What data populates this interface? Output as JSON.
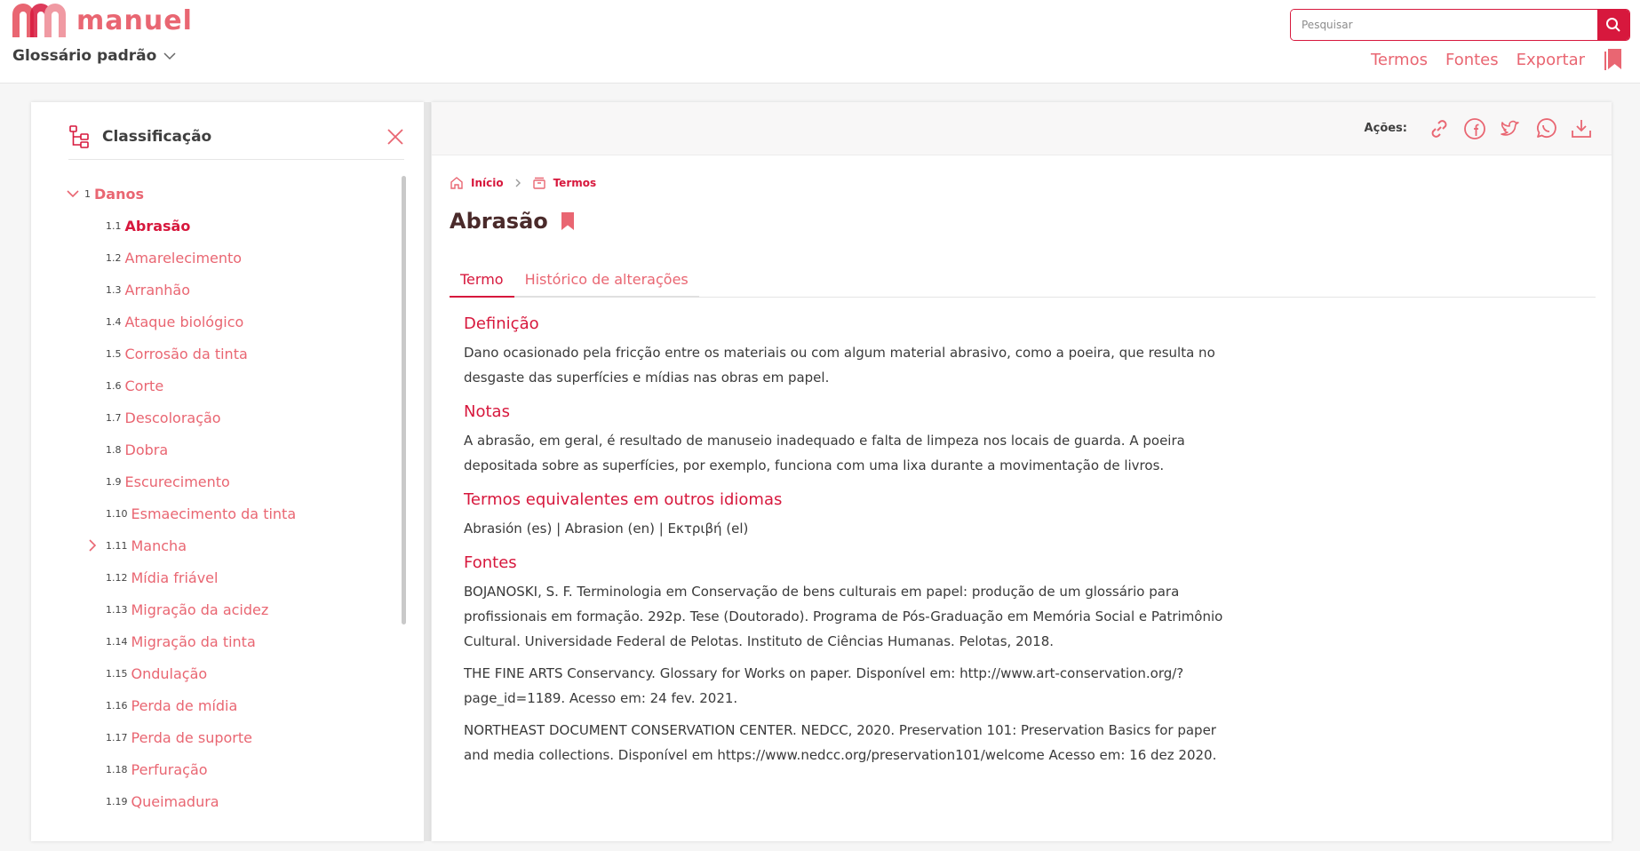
{
  "brand": {
    "name": "manuel",
    "accent": "#e96672",
    "primary": "#d7183d"
  },
  "header": {
    "glossary": "Glossário padrão",
    "search": {
      "placeholder": "Pesquisar",
      "icon": "search-icon"
    },
    "nav": [
      "Termos",
      "Fontes",
      "Exportar"
    ],
    "bookmark_icon": "bookmark-icon"
  },
  "sidebar": {
    "title": "Classificação",
    "root": {
      "num": "1",
      "label": "Danos"
    },
    "items": [
      {
        "num": "1.1",
        "label": "Abrasão",
        "active": true
      },
      {
        "num": "1.2",
        "label": "Amarelecimento"
      },
      {
        "num": "1.3",
        "label": "Arranhão"
      },
      {
        "num": "1.4",
        "label": "Ataque biológico"
      },
      {
        "num": "1.5",
        "label": "Corrosão da tinta"
      },
      {
        "num": "1.6",
        "label": "Corte"
      },
      {
        "num": "1.7",
        "label": "Descoloração"
      },
      {
        "num": "1.8",
        "label": "Dobra"
      },
      {
        "num": "1.9",
        "label": "Escurecimento"
      },
      {
        "num": "1.10",
        "label": "Esmaecimento da tinta"
      },
      {
        "num": "1.11",
        "label": "Mancha",
        "expandable": true
      },
      {
        "num": "1.12",
        "label": "Mídia friável"
      },
      {
        "num": "1.13",
        "label": "Migração da acidez"
      },
      {
        "num": "1.14",
        "label": "Migração da tinta"
      },
      {
        "num": "1.15",
        "label": "Ondulação"
      },
      {
        "num": "1.16",
        "label": "Perda de mídia"
      },
      {
        "num": "1.17",
        "label": "Perda de suporte"
      },
      {
        "num": "1.18",
        "label": "Perfuração"
      },
      {
        "num": "1.19",
        "label": "Queimadura"
      }
    ]
  },
  "main": {
    "actions_label": "Ações:",
    "actions": [
      "link-icon",
      "facebook-icon",
      "twitter-icon",
      "whatsapp-icon",
      "download-icon"
    ],
    "breadcrumb": {
      "home": "Início",
      "terms": "Termos"
    },
    "title": "Abrasão",
    "tabs": [
      "Termo",
      "Histórico de alterações"
    ],
    "definition": {
      "heading": "Definição",
      "text": "Dano ocasionado pela fricção entre os materiais ou com algum material abrasivo, como a poeira, que resulta no desgaste das superfícies e mídias nas obras em papel."
    },
    "notes": {
      "heading": "Notas",
      "text": "A abrasão, em geral, é resultado de manuseio inadequado e falta de limpeza nos locais de guarda. A poeira depositada sobre as superfícies, por exemplo, funciona com uma lixa durante a movimentação de livros."
    },
    "equivalents": {
      "heading": "Termos equivalentes em outros idiomas",
      "text": "Abrasión (es) | Abrasion (en) | Εκτριβή (el)"
    },
    "sources": {
      "heading": "Fontes",
      "refs": [
        "BOJANOSKI, S. F. Terminologia em Conservação de bens culturais em papel: produção de um glossário para profissionais em formação. 292p. Tese (Doutorado). Programa de Pós-Graduação em Memória Social e Patrimônio Cultural. Universidade Federal de Pelotas. Instituto de Ciências Humanas. Pelotas, 2018.",
        "THE FINE ARTS Conservancy. Glossary for Works on paper. Disponível em: http://www.art-conservation.org/?page_id=1189. Acesso em: 24 fev. 2021.",
        "NORTHEAST DOCUMENT CONSERVATION CENTER. NEDCC, 2020. Preservation 101: Preservation Basics for paper and media collections. Disponível em https://www.nedcc.org/preservation101/welcome Acesso em: 16 dez 2020."
      ]
    }
  }
}
